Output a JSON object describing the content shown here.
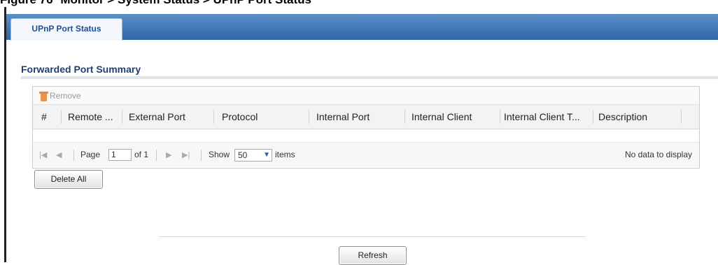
{
  "caption": {
    "figure": "Figure 76",
    "path": "Monitor > System Status > UPnP Port Status"
  },
  "tabs": [
    {
      "label": "UPnP Port Status",
      "active": true
    }
  ],
  "section": {
    "title": "Forwarded Port Summary"
  },
  "toolbar": {
    "remove_label": "Remove",
    "remove_enabled": false,
    "remove_icon": "trash-icon"
  },
  "table": {
    "columns": [
      "#",
      "Remote ...",
      "External Port",
      "Protocol",
      "Internal Port",
      "Internal Client",
      "Internal Client T...",
      "Description"
    ],
    "rows": []
  },
  "pager": {
    "page_label": "Page",
    "page_value": "1",
    "of_label": "of 1",
    "show_label": "Show",
    "show_value": "50",
    "items_label": "items",
    "empty_text": "No data to display"
  },
  "buttons": {
    "delete_all": "Delete All",
    "refresh": "Refresh"
  },
  "colors": {
    "tabbar": "#2e67a8",
    "section_title": "#1d3f78",
    "remove_icon": "#e8934f"
  }
}
